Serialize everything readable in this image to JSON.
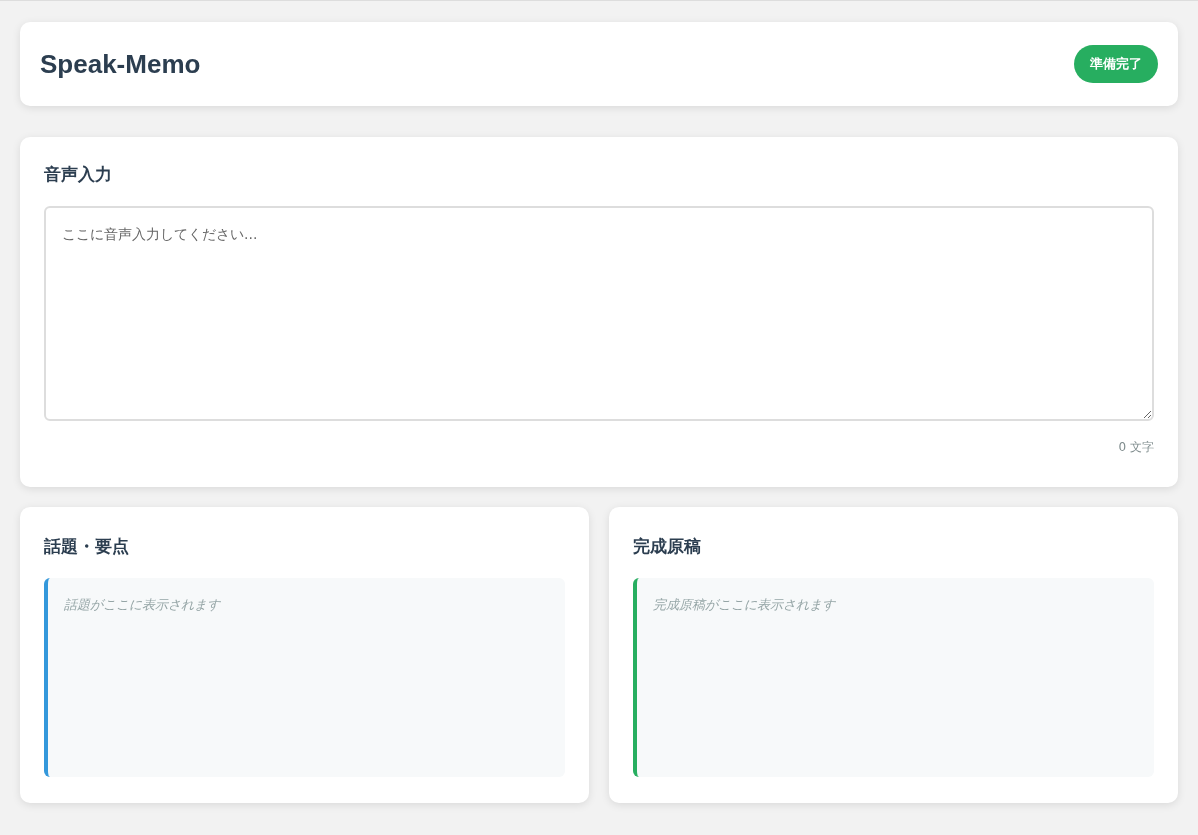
{
  "header": {
    "title": "Speak-Memo",
    "status": {
      "label": "準備完了",
      "kind": "ready"
    }
  },
  "input_section": {
    "title": "音声入力",
    "placeholder": "ここに音声入力してください...",
    "char_count": "0 文字"
  },
  "panels": [
    {
      "title": "話題・要点",
      "placeholder": "話題がここに表示されます",
      "color": "#3498db"
    },
    {
      "title": "完成原稿",
      "placeholder": "完成原稿がここに表示されます",
      "color": "#27ae60"
    }
  ]
}
